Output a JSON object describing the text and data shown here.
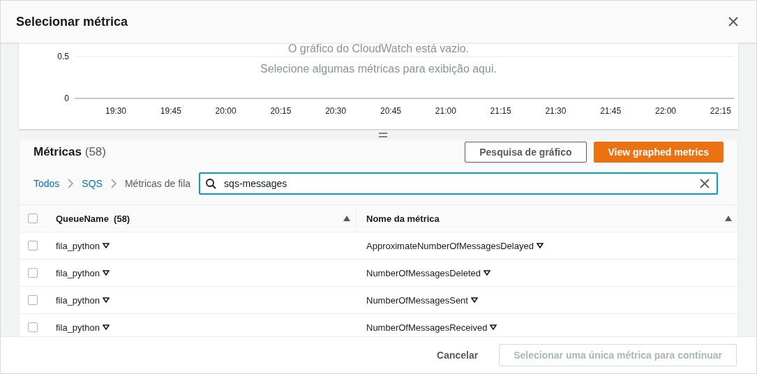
{
  "dialog": {
    "title": "Selecionar métrica"
  },
  "chart": {
    "empty_messages": [
      "O gráfico do CloudWatch está vazio.",
      "Selecione algumas métricas para exibição aqui."
    ],
    "chart_data": {
      "type": "line",
      "categories": [
        "19:30",
        "19:45",
        "20:00",
        "20:15",
        "20:30",
        "20:45",
        "21:00",
        "21:15",
        "21:30",
        "21:45",
        "22:00",
        "22:15"
      ],
      "yticks": [
        0,
        0.5
      ],
      "ylim": [
        0,
        0.5
      ]
    }
  },
  "metrics": {
    "title": "Métricas",
    "count": "(58)",
    "buttons": [
      {
        "label": "Pesquisa de gráfico",
        "kind": "secondary"
      },
      {
        "label": "View graphed metrics",
        "kind": "primary"
      }
    ],
    "breadcrumb": [
      {
        "label": "Todos",
        "link": true
      },
      {
        "label": "SQS",
        "link": true
      },
      {
        "label": "Métricas de fila",
        "link": false
      }
    ],
    "search": {
      "value": "sqs-messages"
    },
    "table": {
      "select_all": false,
      "columns": [
        "QueueName  (58)",
        "Nome da métrica"
      ],
      "rows": [
        {
          "selected": false,
          "queue": "fila_python",
          "metric": "ApproximateNumberOfMessagesDelayed"
        },
        {
          "selected": false,
          "queue": "fila_python",
          "metric": "NumberOfMessagesDeleted"
        },
        {
          "selected": false,
          "queue": "fila_python",
          "metric": "NumberOfMessagesSent"
        },
        {
          "selected": false,
          "queue": "fila_python",
          "metric": "NumberOfMessagesReceived"
        }
      ]
    }
  },
  "footer": {
    "cancel": "Cancelar",
    "confirm": {
      "label": "Selecionar uma única métrica para continuar",
      "disabled": true
    }
  }
}
